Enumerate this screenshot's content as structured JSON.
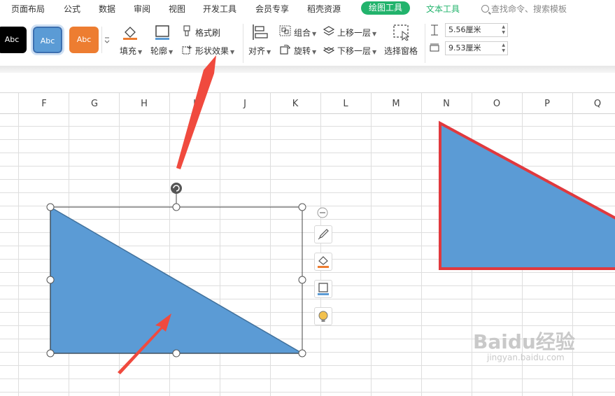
{
  "menu": {
    "items": [
      "页面布局",
      "公式",
      "数据",
      "审阅",
      "视图",
      "开发工具",
      "会员专享",
      "稻壳资源"
    ],
    "active_tab": "绘图工具",
    "text_tool_tab": "文本工具",
    "search_placeholder": "查找命令、搜索模板"
  },
  "ribbon": {
    "style_presets": [
      "Abc",
      "Abc",
      "Abc"
    ],
    "fill": "填充",
    "outline": "轮廓",
    "format_painter": "格式刷",
    "shape_effects": "形状效果",
    "align": "对齐",
    "group": "组合",
    "rotate": "旋转",
    "bring_forward": "上移一层",
    "send_backward": "下移一层",
    "selection_pane": "选择窗格",
    "height": "5.56厘米",
    "width": "9.53厘米"
  },
  "sheet": {
    "columns": [
      "F",
      "G",
      "H",
      "I",
      "J",
      "K",
      "L",
      "M",
      "N",
      "O",
      "P",
      "Q"
    ]
  },
  "colors": {
    "shape_fill": "#5b9bd5",
    "shape_outline_selected": "#41719c",
    "shape_outline_right": "#e0393e",
    "annotation_arrow": "#f04a3e",
    "accent_green": "#22b36c"
  },
  "watermark": {
    "logo": "Baidu经验",
    "url": "jingyan.baidu.com"
  }
}
